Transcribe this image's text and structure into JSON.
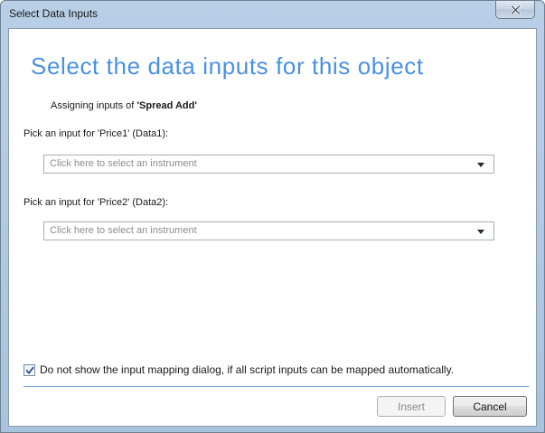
{
  "window": {
    "title": "Select Data Inputs"
  },
  "dialog": {
    "heading": "Select the data inputs for this object",
    "assign_prefix": "Assigning inputs of ",
    "assign_object": "'Spread Add'",
    "inputs": [
      {
        "label": "Pick an input for 'Price1' (Data1):",
        "placeholder": "Click here to select an instrument"
      },
      {
        "label": "Pick an input for 'Price2' (Data2):",
        "placeholder": "Click here to select an instrument"
      }
    ],
    "auto_map_checkbox": {
      "label": "Do not show the input mapping dialog, if all script inputs can be mapped automatically.",
      "checked": true
    }
  },
  "buttons": {
    "insert": "Insert",
    "cancel": "Cancel"
  },
  "icons": {
    "close": "close-icon",
    "dropdown": "chevron-down-icon",
    "check": "check-icon"
  },
  "colors": {
    "heading": "#4a90e2",
    "separator": "#6ea0d8",
    "titlebar": "#b9cfe6"
  }
}
